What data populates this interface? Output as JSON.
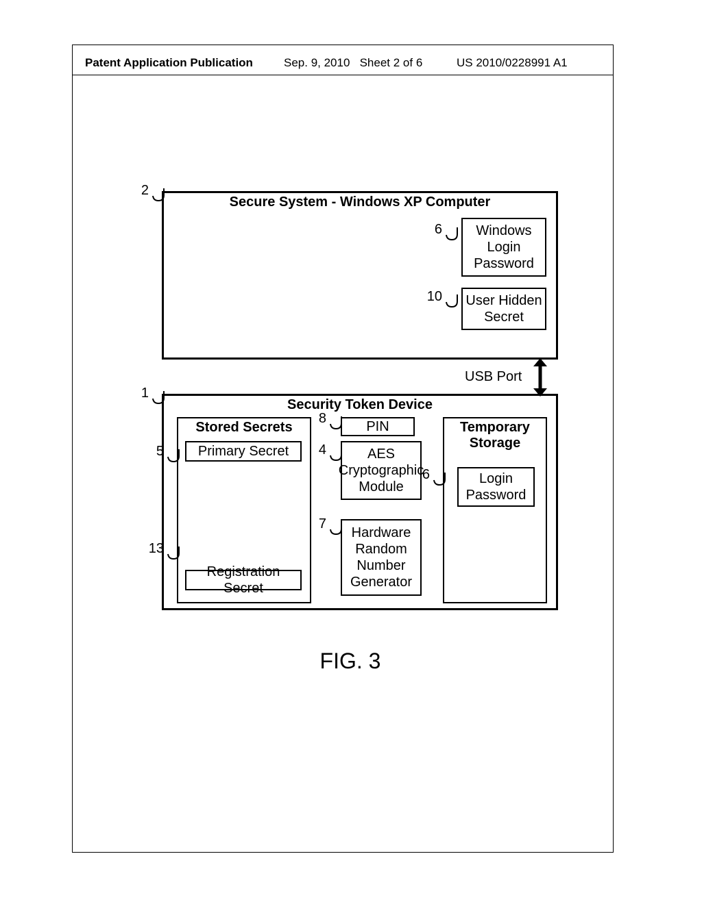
{
  "header": {
    "left": "Patent Application Publication",
    "date": "Sep. 9, 2010",
    "sheet": "Sheet 2 of 6",
    "pubno": "US 2010/0228991 A1"
  },
  "diagram": {
    "top_box": {
      "title": "Secure System - Windows XP Computer",
      "ref": "2",
      "win_login": {
        "ref": "6",
        "text": "Windows\nLogin\nPassword"
      },
      "user_hidden": {
        "ref": "10",
        "text": "User Hidden\nSecret"
      }
    },
    "connector": {
      "label": "USB Port"
    },
    "bottom_box": {
      "title": "Security Token Device",
      "ref": "1",
      "stored_secrets": {
        "title": "Stored Secrets",
        "primary": {
          "ref": "5",
          "text": "Primary Secret"
        },
        "registration": {
          "ref": "13",
          "text": "Registration Secret"
        }
      },
      "mid": {
        "pin": {
          "ref": "8",
          "text": "PIN"
        },
        "aes": {
          "ref": "4",
          "text": "AES\nCryptographic\nModule"
        },
        "hrng": {
          "ref": "7",
          "text": "Hardware\nRandom\nNumber\nGenerator"
        }
      },
      "temp_storage": {
        "title": "Temporary\nStorage",
        "login": {
          "ref": "6",
          "text": "Login\nPassword"
        }
      }
    },
    "figure_label": "FIG. 3"
  }
}
